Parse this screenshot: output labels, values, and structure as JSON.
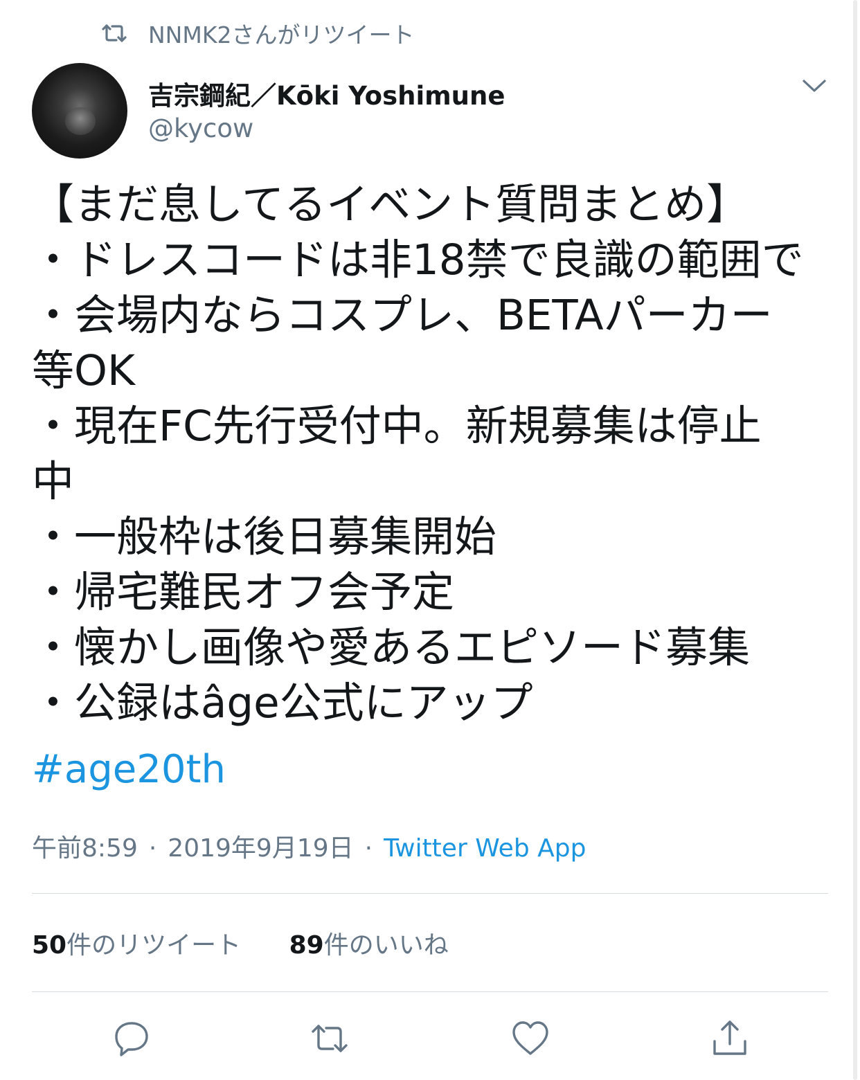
{
  "retweet_context": {
    "icon": "retweet-icon",
    "text": "NNMK2さんがリツイート"
  },
  "author": {
    "display_name": "吉宗鋼紀／Kōki Yoshimune",
    "handle": "@kycow",
    "avatar": "avatar-dog-photo"
  },
  "tweet": {
    "lines": [
      "【まだ息してるイベント質問まとめ】",
      "・ドレスコードは非18禁で良識の範囲で",
      "・会場内ならコスプレ、BETAパーカー",
      "等OK",
      "・現在FC先行受付中。新規募集は停止",
      "中",
      "・一般枠は後日募集開始",
      "・帰宅難民オフ会予定",
      "・懐かし画像や愛あるエピソード募集",
      "・公録はâge公式にアップ"
    ],
    "hashtag": "#age20th"
  },
  "meta": {
    "time": "午前8:59",
    "separator": "·",
    "date": "2019年9月19日",
    "source": "Twitter Web App"
  },
  "stats": {
    "retweets_count": "50",
    "retweets_label": "件のリツイート",
    "likes_count": "89",
    "likes_label": "件のいいね"
  },
  "actions": [
    "reply-icon",
    "retweet-icon",
    "like-icon",
    "share-icon"
  ],
  "colors": {
    "text": "#14171a",
    "secondary": "#657786",
    "link": "#1b95e0",
    "divider": "#d6dbe0"
  }
}
